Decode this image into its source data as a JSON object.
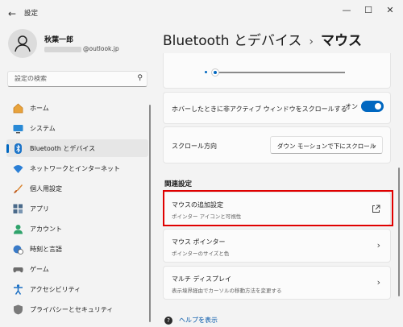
{
  "app": {
    "title": "設定"
  },
  "window_controls": {
    "minimize": "—",
    "maximize": "☐",
    "close": "✕"
  },
  "user": {
    "name": "秋葉一郎",
    "email_suffix": "@outlook.jp"
  },
  "search": {
    "placeholder": "設定の検索"
  },
  "sidebar": {
    "items": [
      {
        "label": "ホーム",
        "icon": "home-icon"
      },
      {
        "label": "システム",
        "icon": "system-display-icon"
      },
      {
        "label": "Bluetooth とデバイス",
        "icon": "bluetooth-icon",
        "selected": true
      },
      {
        "label": "ネットワークとインターネット",
        "icon": "wifi-icon"
      },
      {
        "label": "個人用設定",
        "icon": "paintbrush-icon"
      },
      {
        "label": "アプリ",
        "icon": "apps-icon"
      },
      {
        "label": "アカウント",
        "icon": "account-icon"
      },
      {
        "label": "時刻と言語",
        "icon": "globe-clock-icon"
      },
      {
        "label": "ゲーム",
        "icon": "gamepad-icon"
      },
      {
        "label": "アクセシビリティ",
        "icon": "accessibility-icon"
      },
      {
        "label": "プライバシーとセキュリティ",
        "icon": "shield-icon"
      }
    ]
  },
  "breadcrumb": {
    "parent": "Bluetooth とデバイス",
    "separator": "›",
    "current": "マウス"
  },
  "settings": {
    "slider": {
      "value_fraction": 0.04
    },
    "inactive_scroll": {
      "label": "ホバーしたときに非アクティブ ウィンドウをスクロールする",
      "state": "オン",
      "enabled": true
    },
    "scroll_direction": {
      "label": "スクロール方向",
      "value": "ダウン モーションで下にスクロール"
    }
  },
  "related": {
    "heading": "関連設定",
    "items": [
      {
        "title": "マウスの追加設定",
        "subtitle": "ポインター アイコンと可視性",
        "action_icon": "external-link-icon"
      },
      {
        "title": "マウス ポインター",
        "subtitle": "ポインターのサイズと色",
        "action_icon": "chevron-right-icon"
      },
      {
        "title": "マルチ ディスプレイ",
        "subtitle": "表示境界経由でカーソルの移動方法を変更する",
        "action_icon": "chevron-right-icon"
      }
    ]
  },
  "help": {
    "label": "ヘルプを表示"
  },
  "colors": {
    "accent": "#0067c0",
    "highlight_box": "#e00000",
    "background": "#f3f3f3"
  }
}
